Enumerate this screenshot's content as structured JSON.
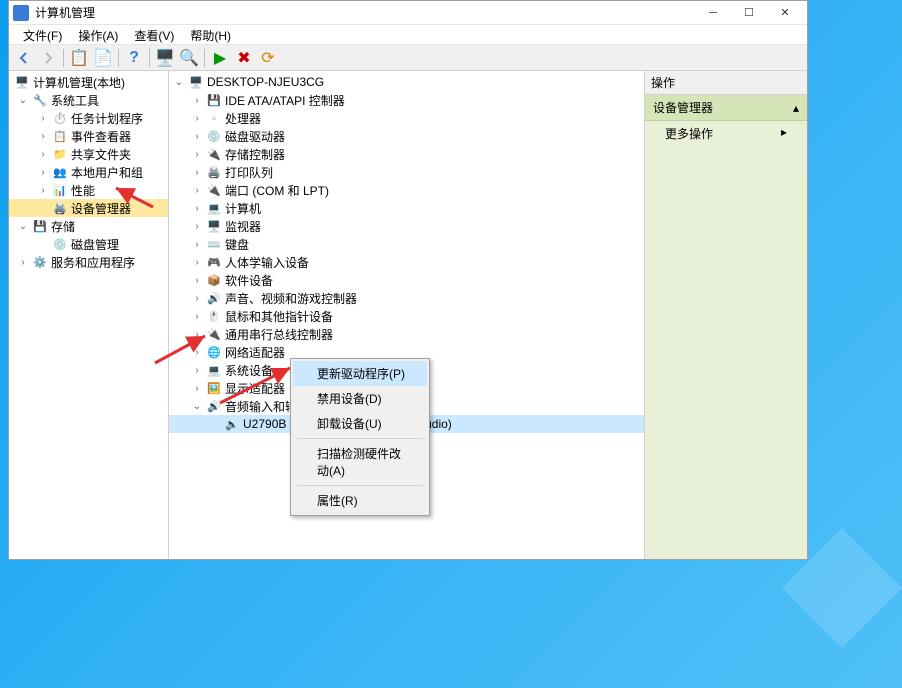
{
  "window": {
    "title": "计算机管理"
  },
  "menu": {
    "file": "文件(F)",
    "action": "操作(A)",
    "view": "查看(V)",
    "help": "帮助(H)"
  },
  "leftTree": {
    "root": "计算机管理(本地)",
    "systemTools": "系统工具",
    "taskScheduler": "任务计划程序",
    "eventViewer": "事件查看器",
    "sharedFolders": "共享文件夹",
    "localUsers": "本地用户和组",
    "performance": "性能",
    "deviceManager": "设备管理器",
    "storage": "存储",
    "diskMgmt": "磁盘管理",
    "services": "服务和应用程序"
  },
  "devTree": {
    "computer": "DESKTOP-NJEU3CG",
    "ide": "IDE ATA/ATAPI 控制器",
    "cpu": "处理器",
    "disk": "磁盘驱动器",
    "storageCtrl": "存储控制器",
    "printQueue": "打印队列",
    "ports": "端口 (COM 和 LPT)",
    "computers": "计算机",
    "monitors": "监视器",
    "keyboards": "键盘",
    "hid": "人体学输入设备",
    "software": "软件设备",
    "sound": "声音、视频和游戏控制器",
    "mouse": "鼠标和其他指针设备",
    "usb": "通用串行总线控制器",
    "network": "网络适配器",
    "system": "系统设备",
    "display": "显示适配器",
    "audioIO": "音频输入和输出",
    "audioDevice": "U2790B (NVIDIA High Definition Audio)"
  },
  "context": {
    "updateDriver": "更新驱动程序(P)",
    "disable": "禁用设备(D)",
    "uninstall": "卸载设备(U)",
    "scan": "扫描检测硬件改动(A)",
    "properties": "属性(R)"
  },
  "actions": {
    "header": "操作",
    "group": "设备管理器",
    "more": "更多操作"
  }
}
